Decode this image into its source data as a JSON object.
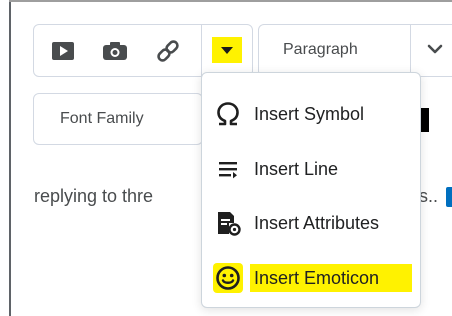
{
  "toolbar": {
    "icons": [
      "media-icon",
      "camera-icon",
      "link-icon",
      "chevron-down-icon"
    ]
  },
  "format": {
    "paragraph_label": "Paragraph",
    "font_family_label": "Font Family"
  },
  "editor": {
    "body_text": "replying to thre",
    "body_tail": "s.."
  },
  "insert_menu": {
    "items": [
      {
        "label": "Insert Symbol",
        "icon": "omega-icon"
      },
      {
        "label": "Insert Line",
        "icon": "horizontal-line-icon"
      },
      {
        "label": "Insert Attributes",
        "icon": "attributes-icon"
      },
      {
        "label": "Insert Emoticon",
        "icon": "emoticon-icon"
      }
    ]
  },
  "colors": {
    "highlight": "#fff200",
    "border": "#d3d9e3",
    "text": "#202122",
    "accent": "#006fbf"
  }
}
